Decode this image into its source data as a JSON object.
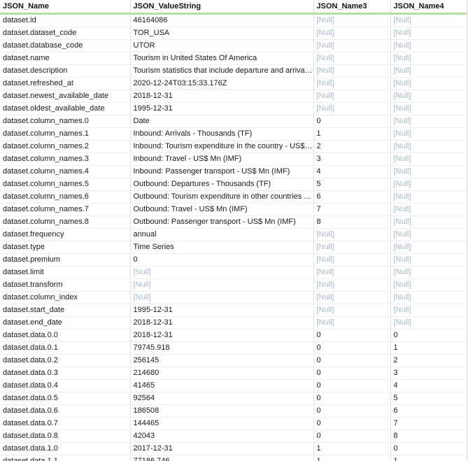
{
  "columns": [
    "JSON_Name",
    "JSON_ValueString",
    "JSON_Name3",
    "JSON_Name4"
  ],
  "null_text": "[Null]",
  "rows": [
    [
      "dataset.id",
      "46164086",
      null,
      null
    ],
    [
      "dataset.dataset_code",
      "TOR_USA",
      null,
      null
    ],
    [
      "dataset.database_code",
      "UTOR",
      null,
      null
    ],
    [
      "dataset.name",
      "Tourism in United States Of America",
      null,
      null
    ],
    [
      "dataset.description",
      "Tourism statistics that include departure and arrivals and expenditure",
      null,
      null
    ],
    [
      "dataset.refreshed_at",
      "2020-12-24T03:15:33.176Z",
      null,
      null
    ],
    [
      "dataset.newest_available_date",
      "2018-12-31",
      null,
      null
    ],
    [
      "dataset.oldest_available_date",
      "1995-12-31",
      null,
      null
    ],
    [
      "dataset.column_names.0",
      "Date",
      "0",
      null
    ],
    [
      "dataset.column_names.1",
      "Inbound: Arrivals - Thousands (TF)",
      "1",
      null
    ],
    [
      "dataset.column_names.2",
      "Inbound: Tourism expenditure in the country - US$ Mn (IMF)",
      "2",
      null
    ],
    [
      "dataset.column_names.3",
      "Inbound: Travel - US$ Mn (IMF)",
      "3",
      null
    ],
    [
      "dataset.column_names.4",
      "Inbound: Passenger transport - US$ Mn (IMF)",
      "4",
      null
    ],
    [
      "dataset.column_names.5",
      "Outbound: Departures - Thousands (TF)",
      "5",
      null
    ],
    [
      "dataset.column_names.6",
      "Outbound: Tourism expenditure in other countries - US$ Mn (IMF)",
      "6",
      null
    ],
    [
      "dataset.column_names.7",
      "Outbound: Travel - US$ Mn (IMF)",
      "7",
      null
    ],
    [
      "dataset.column_names.8",
      "Outbound: Passenger transport - US$ Mn (IMF)",
      "8",
      null
    ],
    [
      "dataset.frequency",
      "annual",
      null,
      null
    ],
    [
      "dataset.type",
      "Time Series",
      null,
      null
    ],
    [
      "dataset.premium",
      "0",
      null,
      null
    ],
    [
      "dataset.limit",
      null,
      null,
      null
    ],
    [
      "dataset.transform",
      null,
      null,
      null
    ],
    [
      "dataset.column_index",
      null,
      null,
      null
    ],
    [
      "dataset.start_date",
      "1995-12-31",
      null,
      null
    ],
    [
      "dataset.end_date",
      "2018-12-31",
      null,
      null
    ],
    [
      "dataset.data.0.0",
      "2018-12-31",
      "0",
      "0"
    ],
    [
      "dataset.data.0.1",
      "79745.918",
      "0",
      "1"
    ],
    [
      "dataset.data.0.2",
      "256145",
      "0",
      "2"
    ],
    [
      "dataset.data.0.3",
      "214680",
      "0",
      "3"
    ],
    [
      "dataset.data.0.4",
      "41465",
      "0",
      "4"
    ],
    [
      "dataset.data.0.5",
      "92564",
      "0",
      "5"
    ],
    [
      "dataset.data.0.6",
      "186508",
      "0",
      "6"
    ],
    [
      "dataset.data.0.7",
      "144465",
      "0",
      "7"
    ],
    [
      "dataset.data.0.8",
      "42043",
      "0",
      "8"
    ],
    [
      "dataset.data.1.0",
      "2017-12-31",
      "1",
      "0"
    ],
    [
      "dataset.data.1.1",
      "77186.746",
      "1",
      "1"
    ]
  ]
}
